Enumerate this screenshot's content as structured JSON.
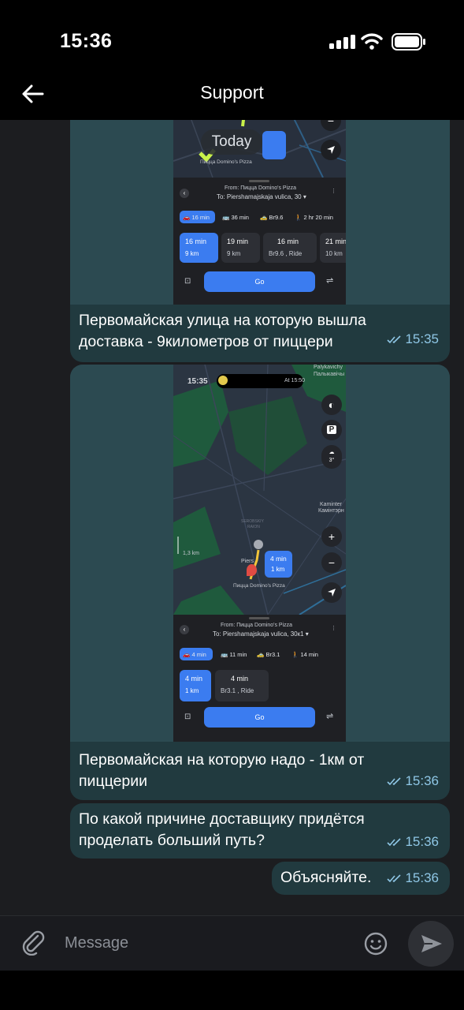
{
  "status_bar": {
    "time": "15:36"
  },
  "header": {
    "title": "Support"
  },
  "date_chip": "Today",
  "screenshot1": {
    "map_label": "Пицца Domino's Pizza",
    "from": "From: Пицца Domino's Pizza",
    "to": "To: Piershamajskaja vulica, 30",
    "modes": [
      "16 min",
      "36 min",
      "Br9.6",
      "2 hr 20 min"
    ],
    "cards": [
      {
        "l1": "16 min",
        "l2": "9 km"
      },
      {
        "l1": "19 min",
        "l2": "9 km"
      },
      {
        "l1": "16 min",
        "l2": "Br9.6 , Ride"
      },
      {
        "l1": "21 min",
        "l2": "10 km"
      }
    ],
    "go": "Go"
  },
  "screenshot2": {
    "phone_time": "15:35",
    "phone_time_right": "At 15:50",
    "map_labels": [
      "Palykavichy",
      "Палыкавічы",
      "Kaminter",
      "Камінтэрн",
      "Piers",
      "Пицца Domino's Pizza",
      "1,3 km",
      "SEROBSKIY",
      "RAION"
    ],
    "bubble_label": {
      "l1": "4 min",
      "l2": "1 km"
    },
    "weather": "3°",
    "from": "From: Пицца Domino's Pizza",
    "to": "To: Piershamajskaja vulica, 30к1",
    "modes": [
      "4 min",
      "11 min",
      "Br3.1",
      "14 min"
    ],
    "cards": [
      {
        "l1": "4 min",
        "l2": "1 km"
      },
      {
        "l1": "4 min",
        "l2": "Br3.1 , Ride"
      }
    ],
    "go": "Go"
  },
  "messages": [
    {
      "text": "Первомайская улица на которую вышла доставка - 9километров от пиццери",
      "time": "15:35"
    },
    {
      "text": "Первомайская на которую надо - 1км от пиццерии",
      "time": "15:36"
    },
    {
      "text": "По какой причине доставщику придётся проделать больший путь?",
      "time": "15:36"
    },
    {
      "text": "Объясняйте.",
      "time": "15:36"
    }
  ],
  "composer": {
    "placeholder": "Message"
  }
}
